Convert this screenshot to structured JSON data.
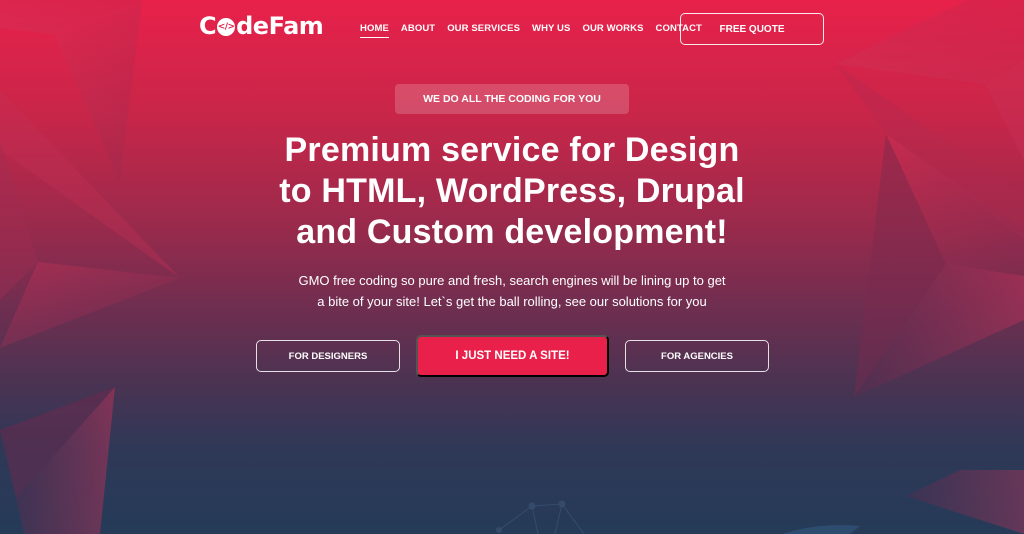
{
  "brand": {
    "name_prefix": "C",
    "logo_glyph": "</>",
    "name_suffix": "deFam",
    "accent_color": "#e8204a"
  },
  "nav": {
    "items": [
      {
        "label": "HOME",
        "active": true
      },
      {
        "label": "ABOUT",
        "active": false
      },
      {
        "label": "OUR SERVICES",
        "active": false
      },
      {
        "label": "WHY US",
        "active": false
      },
      {
        "label": "OUR WORKS",
        "active": false
      },
      {
        "label": "CONTACT",
        "active": false
      }
    ],
    "cta_label": "FREE QUOTE"
  },
  "hero": {
    "badge": "WE DO ALL THE CODING FOR YOU",
    "headline_lines": [
      "Premium service for Design",
      "to HTML, WordPress, Drupal",
      "and Custom development!"
    ],
    "subtext_lines": [
      "GMO free coding so pure and fresh, search engines will be lining up to get",
      "a bite of your site! Let`s get the ball rolling, see our solutions for you"
    ],
    "buttons": {
      "designers": "FOR DESIGNERS",
      "site": "I JUST NEED A SITE!",
      "agencies": "FOR AGENCIES"
    }
  }
}
